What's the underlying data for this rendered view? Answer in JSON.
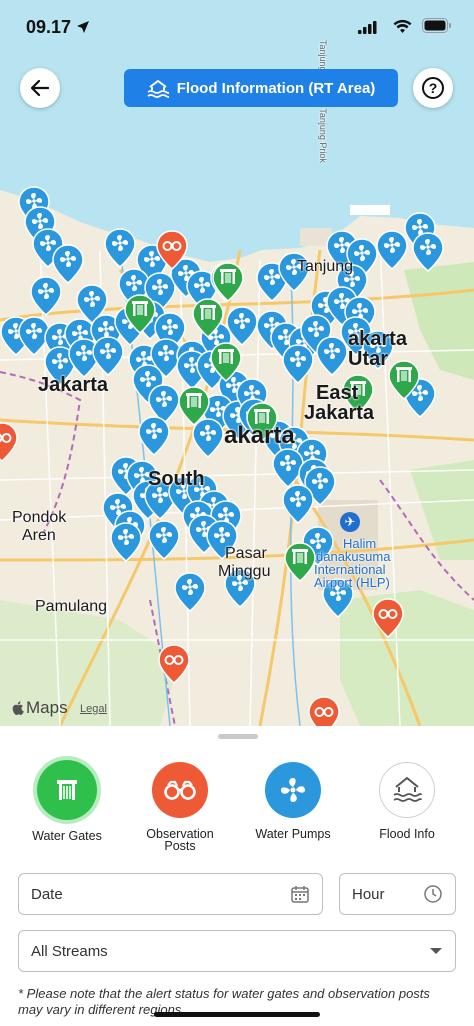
{
  "status": {
    "time": "09.17"
  },
  "header": {
    "title": "Flood Information (RT Area)"
  },
  "map": {
    "labels": {
      "jakarta_west": "Jakarta",
      "jakarta_center": "akarta",
      "jakarta_east_1": "East",
      "jakarta_east_2": "Jakarta",
      "jakarta_north": "akarta",
      "jakarta_north_2": "Utar",
      "south": "South",
      "pondok_1": "Pondok",
      "pondok_2": "Aren",
      "pasar_1": "Pasar",
      "pasar_2": "Minggu",
      "pamulang": "Pamulang",
      "halim_1": "Halim",
      "halim_2": "danakusuma",
      "halim_3": "International",
      "halim_4": "Airport (HLP)",
      "tanjung": "Tanjung",
      "road": "Tanjung Priok — Tanjung Priok",
      "apple_maps": "Maps",
      "legal": "Legal"
    }
  },
  "categories": [
    {
      "label": "Water Gates",
      "icon": "water-gate-icon",
      "color": "#2fc04b"
    },
    {
      "label": "Observation\nPosts",
      "icon": "binoculars-icon",
      "color": "#ee5a36"
    },
    {
      "label": "Water Pumps",
      "icon": "fan-icon",
      "color": "#2b97dc"
    },
    {
      "label": "Flood Info",
      "icon": "flood-house-icon",
      "color": "#ffffff"
    }
  ],
  "filters": {
    "date_placeholder": "Date",
    "hour_placeholder": "Hour",
    "streams_value": "All Streams"
  },
  "note": "* Please note that the alert status for water gates and  observation posts may vary in different regions"
}
